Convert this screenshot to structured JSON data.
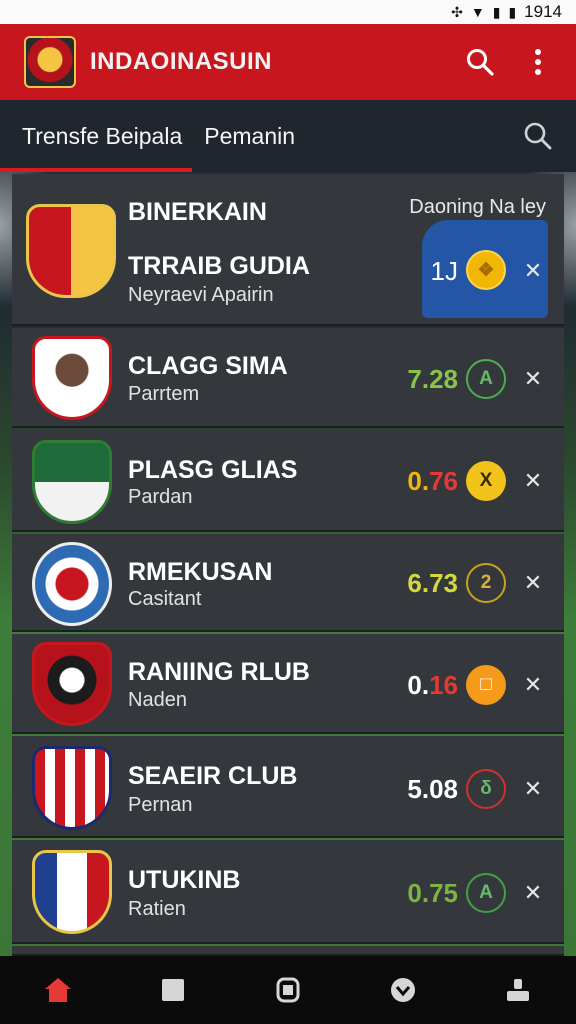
{
  "status": {
    "time": "1914"
  },
  "appbar": {
    "title": "INDAOINASUIN",
    "search_icon": "search-icon",
    "menu_icon": "more-vert-icon"
  },
  "tabs": [
    {
      "label": "Trensfe Beipala",
      "active": true
    },
    {
      "label": "Pemanin",
      "active": false
    }
  ],
  "featured": {
    "title": "BINERKAIN",
    "corner_label": "Daoning Na ley",
    "name": "TRRAIB GUDIA",
    "subtitle": "Neyraevi Apairin",
    "score": "1J",
    "badge_icon": "coin-icon"
  },
  "rows": [
    {
      "name": "CLAGG SIMA",
      "sub": "Parrtem",
      "score": "7.28",
      "score_color": "#8bc34a",
      "badge": "A",
      "badge_style": "outline-green"
    },
    {
      "name": "PLASG GLIAS",
      "sub": "Pardan",
      "score_a": "0.",
      "score_b": "76",
      "score_color": "#f2b705",
      "score_color_b": "#e53935",
      "badge": "X",
      "badge_style": "solid-yellow"
    },
    {
      "name": "RMEKUSAN",
      "sub": "Casitant",
      "score": "6.73",
      "score_color": "#d4d83a",
      "badge": "2",
      "badge_style": "outline-yellow"
    },
    {
      "name": "RANIING RLUB",
      "sub": "Naden",
      "score_a": "0.",
      "score_b": "16",
      "score_color": "#ffffff",
      "score_color_b": "#e53935",
      "badge": "□",
      "badge_style": "solid-orange"
    },
    {
      "name": "SEAEIR CLUB",
      "sub": "Pernan",
      "score": "5.08",
      "score_color": "#ffffff",
      "badge": "δ",
      "badge_style": "outline-red"
    },
    {
      "name": "UTUKINB",
      "sub": "Ratien",
      "score": "0.75",
      "score_color": "#7cb342",
      "badge": "A",
      "badge_style": "outline-green"
    }
  ],
  "nav": [
    {
      "icon": "home-icon",
      "active": true
    },
    {
      "icon": "square-icon",
      "active": false
    },
    {
      "icon": "list-icon",
      "active": false
    },
    {
      "icon": "shield-icon",
      "active": false
    },
    {
      "icon": "profile-icon",
      "active": false
    }
  ],
  "colors": {
    "primary": "#c8161e",
    "tabbar": "#20262d",
    "row": "#34383d",
    "featured_accent": "#2556a6"
  }
}
